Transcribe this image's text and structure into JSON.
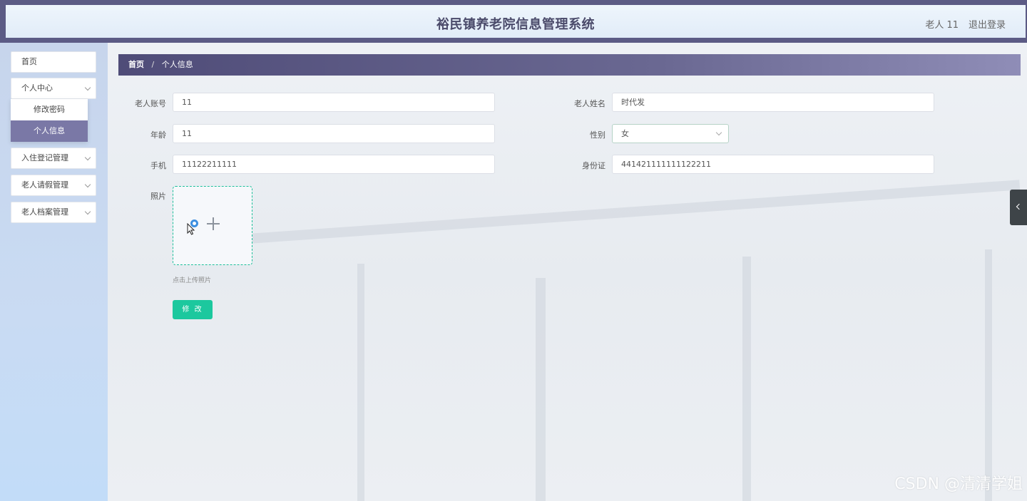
{
  "header": {
    "title": "裕民镇养老院信息管理系统",
    "user": "老人 11",
    "logout": "退出登录"
  },
  "sidebar": {
    "items": [
      {
        "label": "首页"
      },
      {
        "label": "个人中心"
      },
      {
        "label": "入住登记管理"
      },
      {
        "label": "老人请假管理"
      },
      {
        "label": "老人档案管理"
      }
    ],
    "submenu": [
      {
        "label": "修改密码"
      },
      {
        "label": "个人信息"
      }
    ]
  },
  "breadcrumb": {
    "home": "首页",
    "separator": "/",
    "current": "个人信息"
  },
  "form": {
    "account": {
      "label": "老人账号",
      "value": "11"
    },
    "name": {
      "label": "老人姓名",
      "value": "时代发"
    },
    "age": {
      "label": "年龄",
      "value": "11"
    },
    "gender": {
      "label": "性别",
      "value": "女"
    },
    "phone": {
      "label": "手机",
      "value": "11122211111"
    },
    "id_card": {
      "label": "身份证",
      "value": "441421111111122211"
    },
    "photo": {
      "label": "照片",
      "hint": "点击上传照片"
    },
    "submit": "修 改"
  },
  "watermark": "CSDN @清清学姐",
  "colors": {
    "header_bar": "#5c5b85",
    "active_submenu": "#7a78a6",
    "submit": "#1cc89e"
  }
}
